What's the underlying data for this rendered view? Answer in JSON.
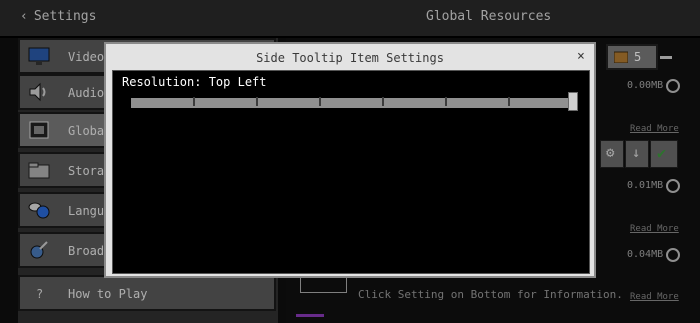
{
  "topbar": {
    "back_label": "Settings",
    "title": "Global Resources"
  },
  "sidebar": {
    "items": [
      {
        "label": "Video"
      },
      {
        "label": "Audio"
      },
      {
        "label": "Global Resources"
      },
      {
        "label": "Storage"
      },
      {
        "label": "Language"
      },
      {
        "label": "Broadcast"
      },
      {
        "label": "How to Play"
      }
    ]
  },
  "main": {
    "count": "5",
    "packs": [
      {
        "size": "0.00MB",
        "read_more": "Read More"
      },
      {
        "size": "0.01MB",
        "read_more": "Read More"
      },
      {
        "size": "0.04MB",
        "read_more": "Read More"
      }
    ],
    "hint": "Click Setting on Bottom for Information."
  },
  "dialog": {
    "title": "Side Tooltip Item Settings",
    "close_glyph": "×",
    "resolution_label": "Resolution: Top Left",
    "slider_value": 1.0
  },
  "colors": {
    "accent": "#3c9a3c",
    "purple": "#8a3ab9"
  }
}
